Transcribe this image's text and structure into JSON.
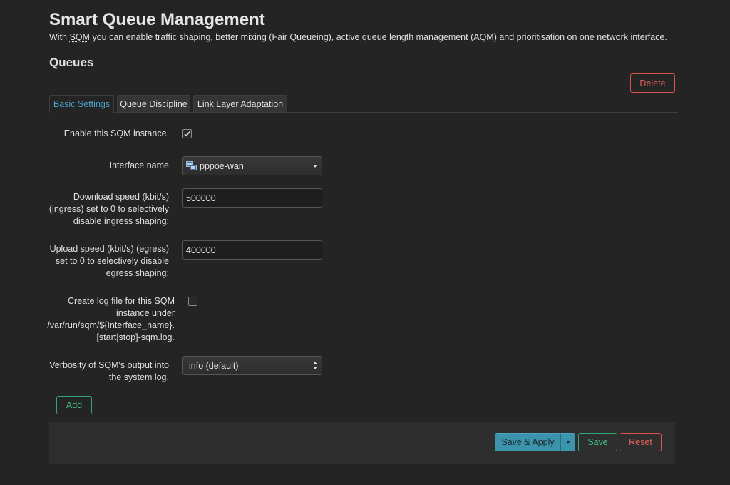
{
  "header": {
    "title": "Smart Queue Management",
    "description_before": "With ",
    "description_abbr": "SQM",
    "description_after": " you can enable traffic shaping, better mixing (Fair Queueing), active queue length management (AQM) and prioritisation on one network interface."
  },
  "section": {
    "title": "Queues",
    "delete_label": "Delete",
    "add_label": "Add"
  },
  "tabs": [
    {
      "label": "Basic Settings",
      "active": true
    },
    {
      "label": "Queue Discipline",
      "active": false
    },
    {
      "label": "Link Layer Adaptation",
      "active": false
    }
  ],
  "form": {
    "enable": {
      "label": "Enable this SQM instance.",
      "checked": true
    },
    "interface": {
      "label": "Interface name",
      "value": "pppoe-wan",
      "icon": "network-interface-icon"
    },
    "download": {
      "label_lines": [
        "Download speed (kbit/s)",
        "(ingress) set to 0 to selectively",
        "disable ingress shaping:"
      ],
      "value": "500000"
    },
    "upload": {
      "label_lines": [
        "Upload speed (kbit/s) (egress)",
        "set to 0 to selectively disable",
        "egress shaping:"
      ],
      "value": "400000"
    },
    "log": {
      "label_lines": [
        "Create log file for this SQM",
        "instance under",
        "/var/run/sqm/${Interface_name}.",
        "[start|stop]-sqm.log."
      ],
      "checked": false
    },
    "verbosity": {
      "label_lines": [
        "Verbosity of SQM's output into",
        "the system log."
      ],
      "value": "info (default)"
    }
  },
  "footer": {
    "save_apply_label": "Save & Apply",
    "save_label": "Save",
    "reset_label": "Reset"
  },
  "colors": {
    "accent_blue": "#3c94ac",
    "danger_red": "#d9534f",
    "success_green": "#2fa874",
    "background": "#242424"
  }
}
